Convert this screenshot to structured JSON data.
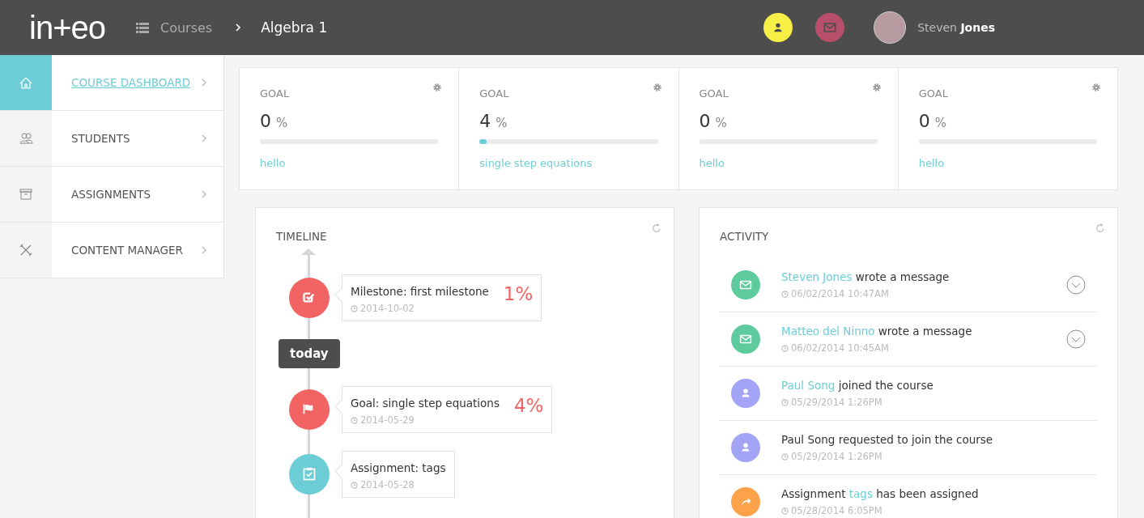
{
  "header": {
    "logo": "in+eo",
    "breadcrumb": [
      {
        "label": "Courses"
      },
      {
        "label": "Algebra 1"
      }
    ],
    "user_name": "Steven **Jones**"
  },
  "sidebar": {
    "items": [
      {
        "label": "COURSE DASHBOARD",
        "kind": "home",
        "selected": true
      },
      {
        "label": "STUDENTS",
        "kind": "students",
        "selected": false
      },
      {
        "label": "ASSIGNMENTS",
        "kind": "assignments",
        "selected": false
      },
      {
        "label": "CONTENT MANAGER",
        "kind": "tools",
        "selected": false
      }
    ]
  },
  "goals": [
    {
      "title": "GOAL",
      "value": "0",
      "unit": "%",
      "level": 0,
      "name": "hello"
    },
    {
      "title": "GOAL",
      "value": "4",
      "unit": "%",
      "level": 0.04,
      "name": "single step equations"
    },
    {
      "title": "GOAL",
      "value": "0",
      "unit": "%",
      "level": 0,
      "name": "hello"
    },
    {
      "title": "GOAL",
      "value": "0",
      "unit": "%",
      "level": 0,
      "name": "hello"
    }
  ],
  "timeline": {
    "title": "TIMELINE",
    "items": [
      {
        "kind": "milestone",
        "title": "Milestone: first milestone",
        "percent": "1%",
        "date": "2014-10-02"
      },
      {
        "kind": "today",
        "title": "today"
      },
      {
        "kind": "goal",
        "title": "Goal: single step equations",
        "percent": "4%",
        "date": "2014-05-29"
      },
      {
        "kind": "assignment",
        "title": "Assignment: tags",
        "date": "2014-05-28"
      }
    ]
  },
  "activity": {
    "title": "ACTIVITY",
    "items": [
      {
        "kind": "message",
        "parts": [
          {
            "text": "Steven Jones",
            "link": true
          },
          {
            "text": " wrote a message",
            "link": false
          }
        ],
        "time": "06/02/2014 10:47AM",
        "expandable": true
      },
      {
        "kind": "message",
        "parts": [
          {
            "text": "Matteo del Ninno",
            "link": true
          },
          {
            "text": " wrote a message",
            "link": false
          }
        ],
        "time": "06/02/2014 10:45AM",
        "expandable": true
      },
      {
        "kind": "user",
        "parts": [
          {
            "text": "Paul Song",
            "link": true
          },
          {
            "text": " joined the course",
            "link": false
          }
        ],
        "time": "05/29/2014 1:26PM",
        "expandable": false
      },
      {
        "kind": "user",
        "parts": [
          {
            "text": "Paul Song requested to join the course",
            "link": false
          }
        ],
        "time": "05/29/2014 1:26PM",
        "expandable": false
      },
      {
        "kind": "share",
        "parts": [
          {
            "text": "Assignment ",
            "link": false
          },
          {
            "text": "tags",
            "link": true
          },
          {
            "text": " has been assigned",
            "link": false
          }
        ],
        "time": "05/28/2014 6:05PM",
        "expandable": false
      }
    ]
  }
}
